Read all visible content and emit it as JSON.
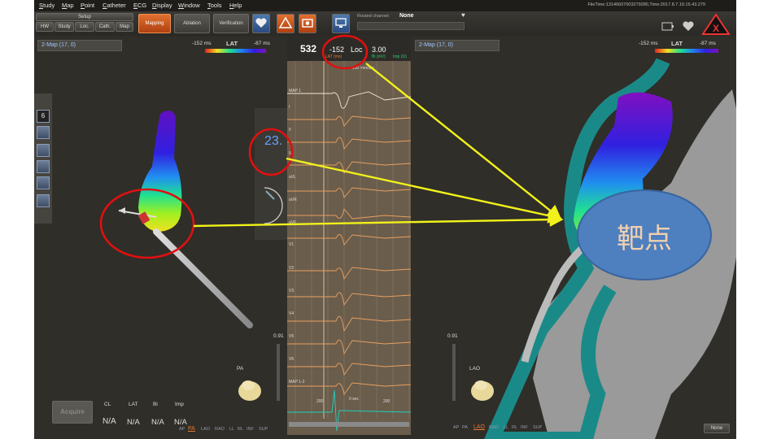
{
  "menu": [
    "Study",
    "Map",
    "Point",
    "Catheter",
    "ECG",
    "Display",
    "Window",
    "Tools",
    "Help"
  ],
  "file_time": "FileTime:13146607003279280,Time:2017.8.7.19.16.43.279",
  "toolbar": {
    "setup_label": "Setup",
    "tabs": [
      "HW",
      "Study",
      "Loc.",
      "Cath.",
      "Map"
    ],
    "mapping": "Mapping",
    "ablation": "Ablation",
    "verification": "Verification",
    "routed_channel_label": "Routed channel:",
    "routed_channel_value": "None"
  },
  "left_map": {
    "title": "2-Map (17, 0)",
    "lat_min": "-152 ms",
    "lat_label": "LAT",
    "lat_max": "-87 ms",
    "side_number": "6",
    "zoom": "0.91",
    "view": "PA",
    "view_tabs": [
      "AP",
      "PA",
      "LAO",
      "RAO",
      "LL",
      "RL",
      "INF",
      "SUP"
    ],
    "active_view": "PA"
  },
  "right_map": {
    "title": "2-Map (17, 0)",
    "lat_min": "-152 ms",
    "lat_label": "LAT",
    "lat_max": "-87 ms",
    "zoom": "0.91",
    "view": "LAO",
    "view_tabs": [
      "AP",
      "PA",
      "LAO",
      "RAO",
      "LL",
      "RL",
      "INF",
      "SUP"
    ],
    "active_view": "LAO",
    "none_select": "None"
  },
  "readouts": {
    "acquire": "Acquire",
    "headers": [
      "CL",
      "LAT",
      "Bi",
      "Imp"
    ],
    "values": [
      "N/A",
      "N/A",
      "N/A",
      "N/A"
    ],
    "force_value": "23.",
    "cycle": "532",
    "lat_value": "-152",
    "lat_unit": "LAT (ms)",
    "loc": "Loc",
    "bi_value": "3.00",
    "bi_unit": "Bi (mV)",
    "imp_unit": "Imp (Ω)"
  },
  "ecg": {
    "scale": "100 mm/sec",
    "leads": [
      "MAP 1",
      "I",
      "II",
      "III",
      "aVL",
      "aVR",
      "aVF",
      "V1",
      "V2",
      "V3",
      "V4",
      "V5",
      "V6",
      "MAP 1-2"
    ],
    "time_labels": [
      "200",
      "0 sec",
      "200"
    ]
  },
  "annotation": {
    "target_label": "靶点",
    "colors": {
      "circle": "#e01010",
      "arrow": "#f2f21a",
      "bubble": "#4e7fbf"
    }
  }
}
